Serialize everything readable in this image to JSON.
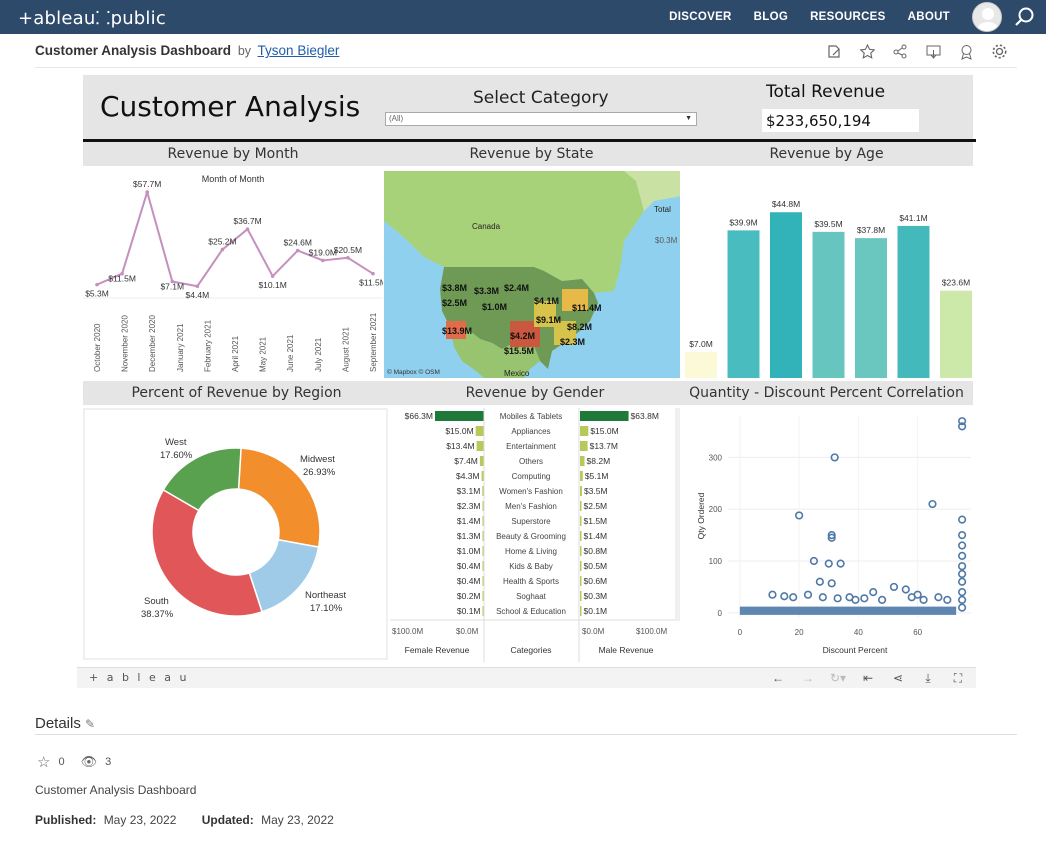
{
  "nav": {
    "logo": "+ableau⸬public",
    "links": [
      "DISCOVER",
      "BLOG",
      "RESOURCES",
      "ABOUT"
    ]
  },
  "viz": {
    "title": "Customer Analysis Dashboard",
    "by": "by",
    "author": "Tyson Biegler"
  },
  "dashboard": {
    "title": "Customer Analysis",
    "category_label": "Select Category",
    "category_value": "(All)",
    "total_revenue_label": "Total Revenue",
    "total_revenue_value": "$233,650,194",
    "sections": {
      "month": "Revenue by Month",
      "state": "Revenue by State",
      "age": "Revenue by Age",
      "region": "Percent of Revenue by Region",
      "gender": "Revenue by Gender",
      "corr": "Quantity - Discount Percent Correlation"
    }
  },
  "chart_data": [
    {
      "type": "line",
      "title": "Month of Month",
      "x": [
        "October 2020",
        "November 2020",
        "December 2020",
        "January 2021",
        "February 2021",
        "April 2021",
        "May 2021",
        "June 2021",
        "July 2021",
        "August 2021",
        "September 2021"
      ],
      "values": [
        5.3,
        11.5,
        57.7,
        7.1,
        4.4,
        25.2,
        36.7,
        10.1,
        24.6,
        19.0,
        20.5,
        11.5
      ],
      "labels": [
        "$5.3M",
        "$11.5M",
        "$57.7M",
        "$7.1M",
        "$4.4M",
        "$25.2M",
        "$36.7M",
        "$10.1M",
        "$24.6M",
        "$19.0M",
        "$20.5M",
        "$11.5M"
      ],
      "color": "#c58fbe"
    },
    {
      "type": "bar",
      "values": [
        7.0,
        39.9,
        44.8,
        39.5,
        37.8,
        41.1,
        23.6
      ],
      "labels": [
        "$7.0M",
        "$39.9M",
        "$44.8M",
        "$39.5M",
        "$37.8M",
        "$41.1M",
        "$23.6M"
      ],
      "colors": [
        "#fbf9d6",
        "#49bcc0",
        "#32b3ba",
        "#67c5c0",
        "#6ac7bf",
        "#44b9bb",
        "#cde9a9"
      ]
    },
    {
      "type": "pie",
      "series": [
        {
          "name": "Midwest",
          "pct": 26.93,
          "label": "26.93%",
          "color": "#f28e2b"
        },
        {
          "name": "Northeast",
          "pct": 17.1,
          "label": "17.10%",
          "color": "#a0cbe8"
        },
        {
          "name": "South",
          "pct": 38.37,
          "label": "38.37%",
          "color": "#e15759"
        },
        {
          "name": "West",
          "pct": 17.6,
          "label": "17.60%",
          "color": "#59a14f"
        }
      ]
    },
    {
      "type": "bar",
      "categories": [
        "Mobiles & Tablets",
        "Appliances",
        "Entertainment",
        "Others",
        "Computing",
        "Women's Fashion",
        "Men's Fashion",
        "Superstore",
        "Beauty & Grooming",
        "Home & Living",
        "Kids & Baby",
        "Health & Sports",
        "Soghaat",
        "School & Education"
      ],
      "female": [
        66.3,
        15.0,
        13.4,
        7.4,
        4.3,
        3.1,
        2.3,
        1.4,
        1.3,
        1.0,
        0.4,
        0.4,
        0.2,
        0.1
      ],
      "female_labels": [
        "$66.3M",
        "$15.0M",
        "$13.4M",
        "$7.4M",
        "$4.3M",
        "$3.1M",
        "$2.3M",
        "$1.4M",
        "$1.3M",
        "$1.0M",
        "$0.4M",
        "$0.4M",
        "$0.2M",
        "$0.1M"
      ],
      "male": [
        63.8,
        15.0,
        13.7,
        8.2,
        5.1,
        3.5,
        2.5,
        1.5,
        1.4,
        0.8,
        0.5,
        0.6,
        0.3,
        0.1
      ],
      "male_labels": [
        "$63.8M",
        "$15.0M",
        "$13.7M",
        "$8.2M",
        "$5.1M",
        "$3.5M",
        "$2.5M",
        "$1.5M",
        "$1.4M",
        "$0.8M",
        "$0.5M",
        "$0.6M",
        "$0.3M",
        "$0.1M"
      ],
      "axis_female": [
        "$100.0M",
        "$0.0M"
      ],
      "axis_male": [
        "$0.0M",
        "$100.0M"
      ],
      "footer": [
        "Female Revenue",
        "Categories",
        "Male Revenue"
      ],
      "color_top": "#1f7a3a",
      "color_rest": "#b8c95a"
    },
    {
      "type": "scatter",
      "xlabel": "Discount Percent",
      "ylabel": "Qty Ordered",
      "xticks": [
        0,
        20,
        40,
        60
      ],
      "yticks": [
        0,
        100,
        200,
        300
      ],
      "xlim": [
        -4,
        78
      ],
      "ylim": [
        -10,
        380
      ],
      "points": [
        [
          20,
          188
        ],
        [
          31,
          150
        ],
        [
          31,
          145
        ],
        [
          32,
          300
        ],
        [
          25,
          100
        ],
        [
          30,
          95
        ],
        [
          34,
          95
        ],
        [
          27,
          60
        ],
        [
          31,
          57
        ],
        [
          65,
          210
        ],
        [
          75,
          370
        ],
        [
          75,
          360
        ],
        [
          75,
          180
        ],
        [
          75,
          150
        ],
        [
          75,
          130
        ],
        [
          75,
          110
        ],
        [
          75,
          90
        ],
        [
          75,
          75
        ],
        [
          75,
          60
        ],
        [
          75,
          40
        ],
        [
          75,
          25
        ],
        [
          75,
          10
        ],
        [
          45,
          40
        ],
        [
          52,
          50
        ],
        [
          56,
          45
        ],
        [
          60,
          35
        ],
        [
          11,
          35
        ],
        [
          15,
          32
        ],
        [
          18,
          30
        ],
        [
          23,
          35
        ],
        [
          28,
          30
        ],
        [
          33,
          28
        ],
        [
          37,
          30
        ],
        [
          39,
          25
        ],
        [
          42,
          28
        ],
        [
          48,
          25
        ],
        [
          58,
          30
        ],
        [
          62,
          25
        ],
        [
          67,
          30
        ],
        [
          70,
          25
        ]
      ],
      "band": [
        0,
        73
      ],
      "color": "#4e79a7"
    }
  ],
  "map_labels": {
    "countries": [
      "Canada",
      "Mexico"
    ],
    "total": "Total",
    "total_val": "$0.3M",
    "states": [
      "$3.8M",
      "$3.3M",
      "$2.4M",
      "$2.5M",
      "$1.0M",
      "$4.1M",
      "$11.4M",
      "$9.1M",
      "$8.2M",
      "$13.9M",
      "$4.2M",
      "$2.3M",
      "$15.5M"
    ],
    "credit": "© Mapbox © OSM"
  },
  "toolbar": {
    "logo": "+ a b l e a u"
  },
  "details": {
    "title": "Details",
    "favorites": "0",
    "views": "3",
    "description": "Customer Analysis Dashboard",
    "published_label": "Published:",
    "published": "May 23, 2022",
    "updated_label": "Updated:",
    "updated": "May 23, 2022"
  }
}
